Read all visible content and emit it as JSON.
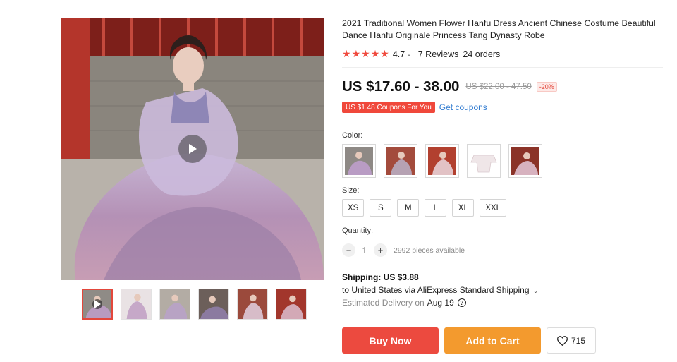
{
  "product": {
    "title": "2021 Traditional Women Flower Hanfu Dress Ancient Chinese Costume Beautiful Dance Hanfu Originale Princess Tang Dynasty Robe",
    "rating": "4.7",
    "reviews": "7 Reviews",
    "orders": "24 orders"
  },
  "price": {
    "current": "US $17.60 - 38.00",
    "original": "US $22.00 - 47.50",
    "discount": "-20%"
  },
  "coupon": {
    "tag": "US $1.48 Coupons For You",
    "link": "Get coupons"
  },
  "color": {
    "label": "Color:",
    "options": [
      "purple-dress-swatch",
      "mauve-dress-swatch",
      "red-background-swatch",
      "white-robe-swatch",
      "red-temple-swatch"
    ]
  },
  "size": {
    "label": "Size:",
    "options": [
      "XS",
      "S",
      "M",
      "L",
      "XL",
      "XXL"
    ]
  },
  "quantity": {
    "label": "Quantity:",
    "value": "1",
    "minus": "−",
    "plus": "+",
    "available": "2992 pieces available"
  },
  "shipping": {
    "price": "Shipping: US $3.88",
    "via": "to United States via AliExpress Standard Shipping",
    "estimate_label": "Estimated Delivery on",
    "estimate_date": "Aug 19",
    "help": "?"
  },
  "actions": {
    "buy_now": "Buy Now",
    "add_to_cart": "Add to Cart",
    "wishlist_count": "715"
  },
  "icons": {
    "star": "star-icon",
    "play": "play-icon",
    "heart": "heart-icon",
    "chevron": "chevron-down-icon"
  },
  "colors": {
    "accent_red": "#ec4a3f",
    "accent_orange": "#f39a2e",
    "link_blue": "#2f7ad0",
    "star_red": "#f04a3e"
  }
}
